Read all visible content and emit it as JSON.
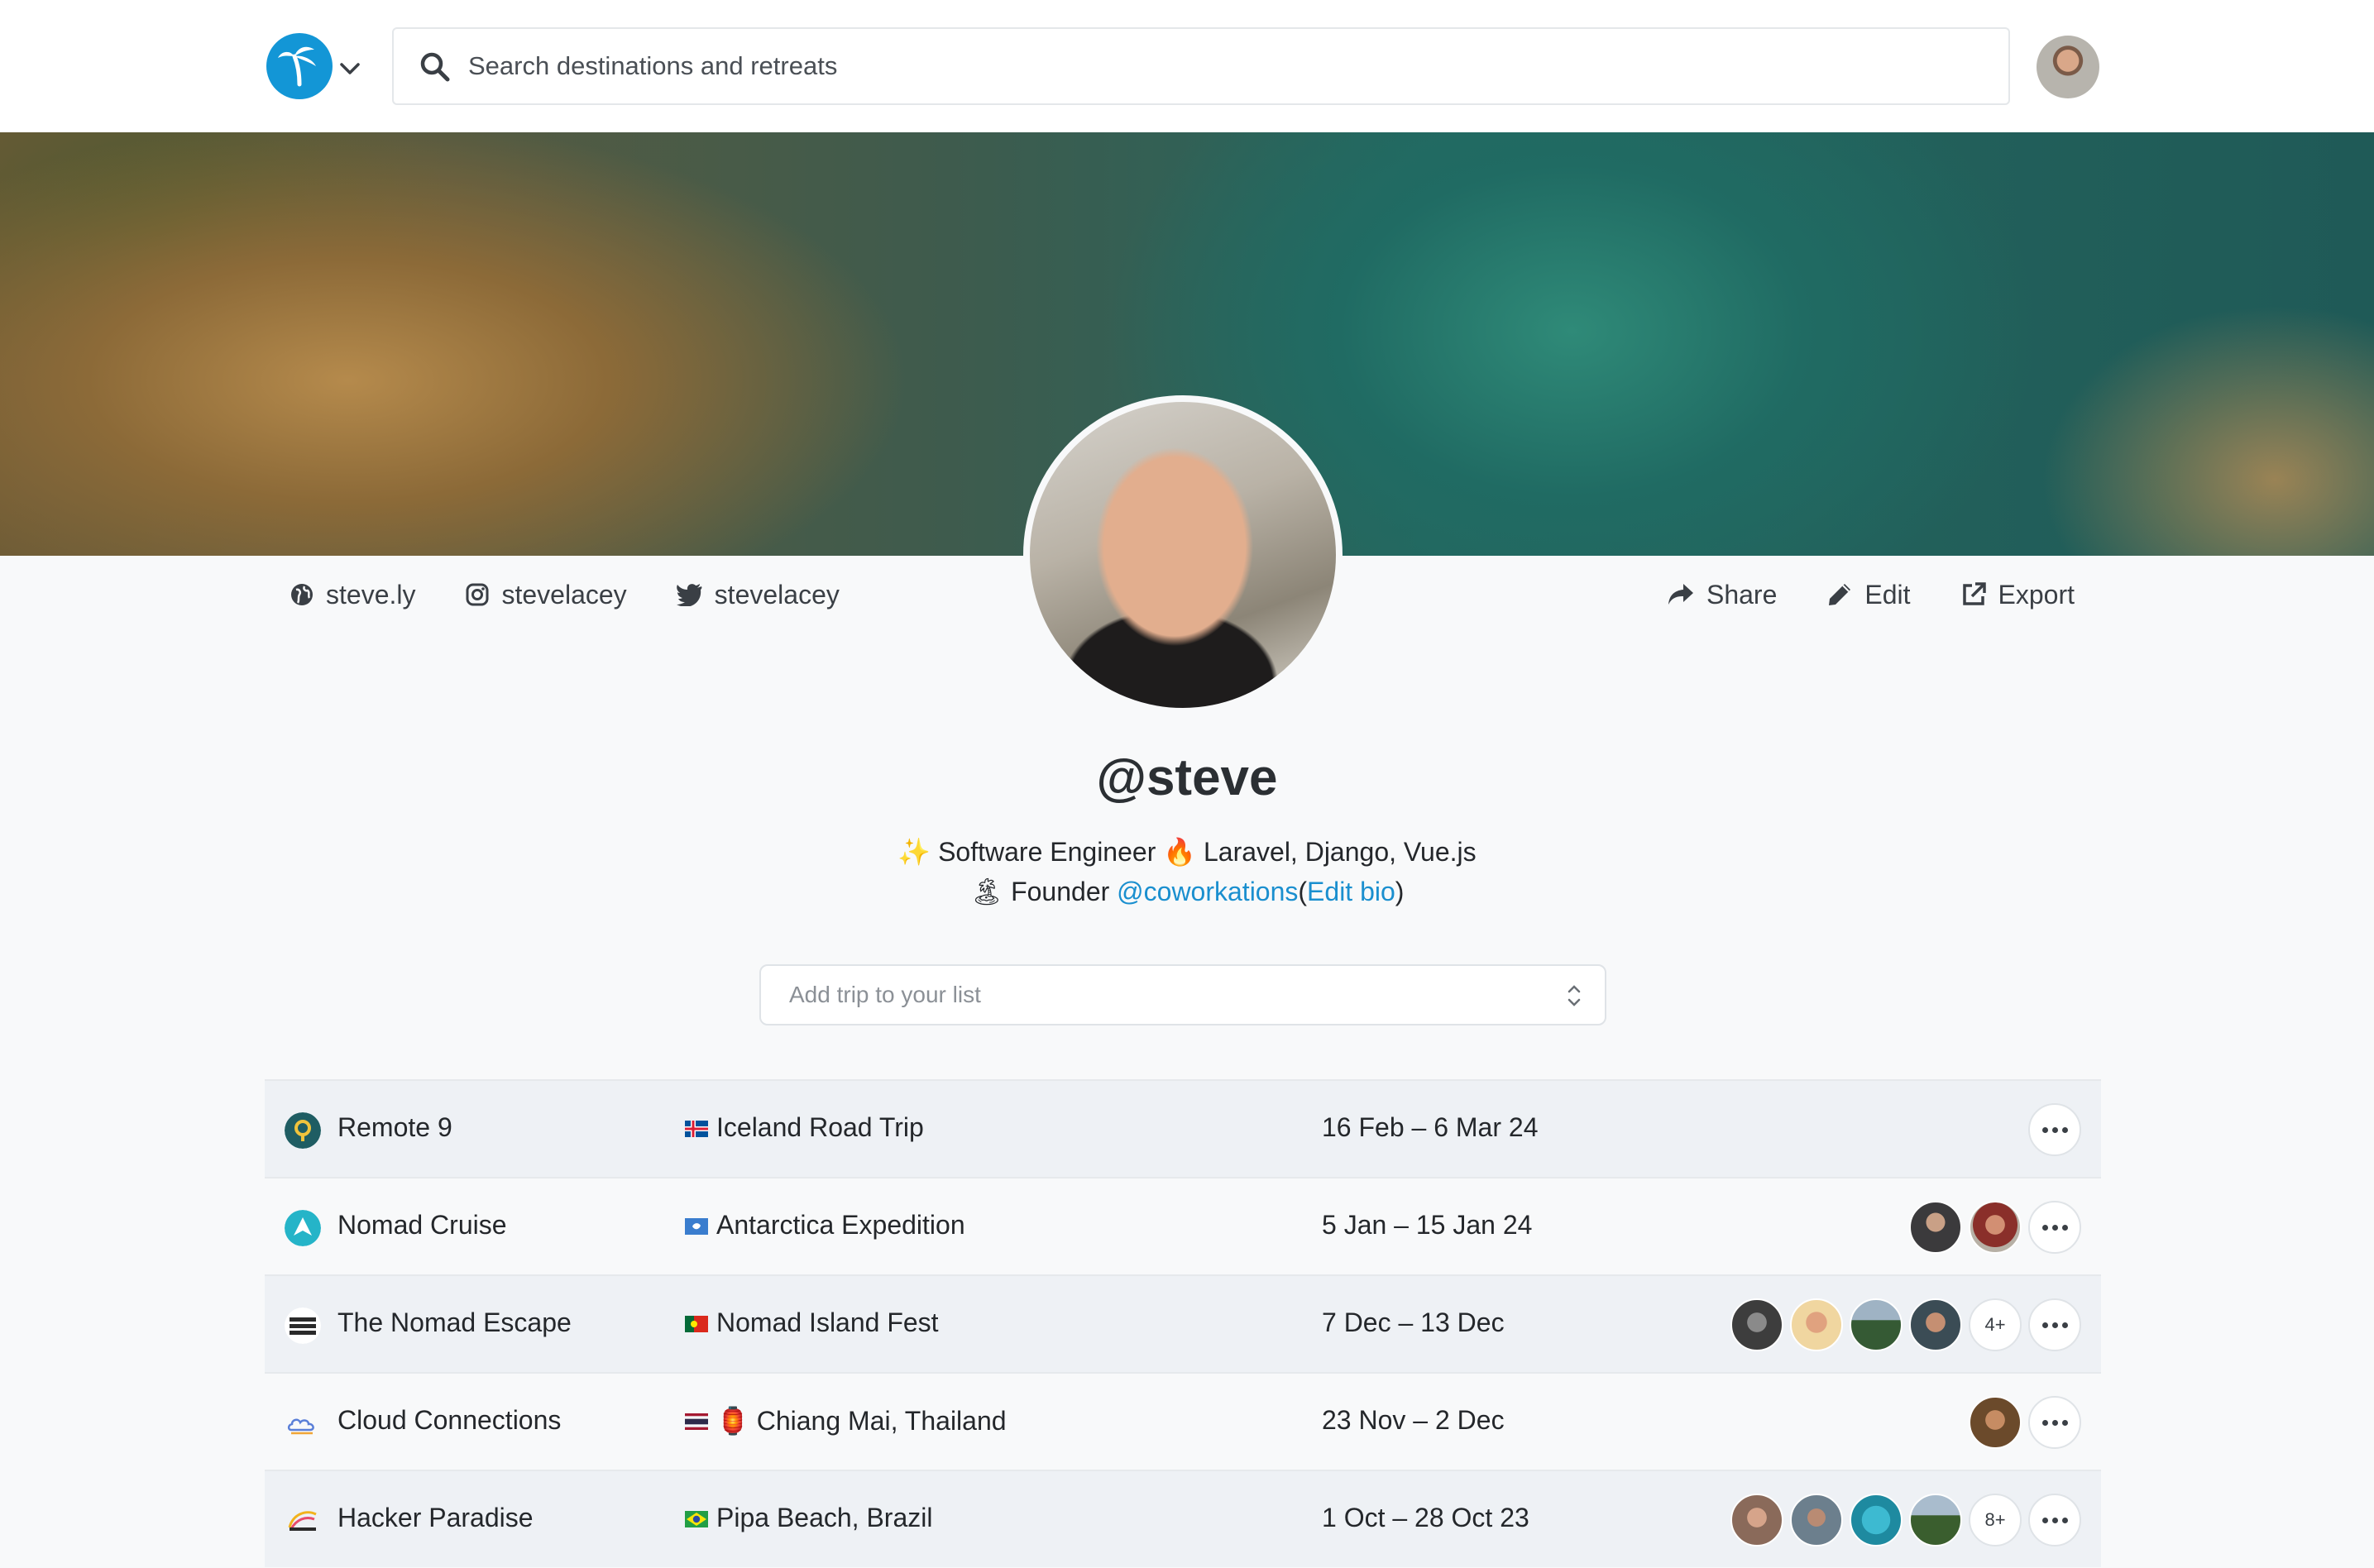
{
  "header": {
    "search_placeholder": "Search destinations and retreats"
  },
  "profile": {
    "username": "@steve",
    "bio_line1_emoji": "✨",
    "bio_line1_part1": "Software Engineer",
    "bio_line1_emoji2": "🔥",
    "bio_line1_part2": "Laravel, Django, Vue.js",
    "bio_line2_emoji": "🏝",
    "bio_line2_text": "Founder",
    "bio_line2_link": "@coworkations",
    "bio_edit_open": "(",
    "bio_edit_link": "Edit bio",
    "bio_edit_close": ")"
  },
  "links": [
    {
      "label": "steve.ly",
      "icon": "globe-icon"
    },
    {
      "label": "stevelacey",
      "icon": "instagram-icon"
    },
    {
      "label": "stevelacey",
      "icon": "twitter-icon"
    }
  ],
  "actions": {
    "share": "Share",
    "edit": "Edit",
    "export": "Export"
  },
  "add_trip": {
    "placeholder": "Add trip to your list"
  },
  "trips": [
    {
      "org": "Remote 9",
      "trip": "Iceland Road Trip",
      "dates": "16 Feb – 6 Mar 24",
      "flag": "iceland-flag",
      "extra": ""
    },
    {
      "org": "Nomad Cruise",
      "trip": "Antarctica Expedition",
      "dates": "5 Jan – 15 Jan 24",
      "flag": "antarctica-flag",
      "extra": ""
    },
    {
      "org": "The Nomad Escape",
      "trip": "Nomad Island Fest",
      "dates": "7 Dec – 13 Dec",
      "flag": "portugal-flag",
      "extra": "4+"
    },
    {
      "org": "Cloud Connections",
      "trip": "🏮 Chiang Mai, Thailand",
      "dates": "23 Nov – 2 Dec",
      "flag": "thailand-flag",
      "extra": ""
    },
    {
      "org": "Hacker Paradise",
      "trip": "Pipa Beach, Brazil",
      "dates": "1 Oct – 28 Oct 23",
      "flag": "brazil-flag",
      "extra": "8+"
    }
  ],
  "colors": {
    "accent": "#1396d6",
    "link": "#1a8fcf",
    "row_alt": "#eef1f5"
  }
}
